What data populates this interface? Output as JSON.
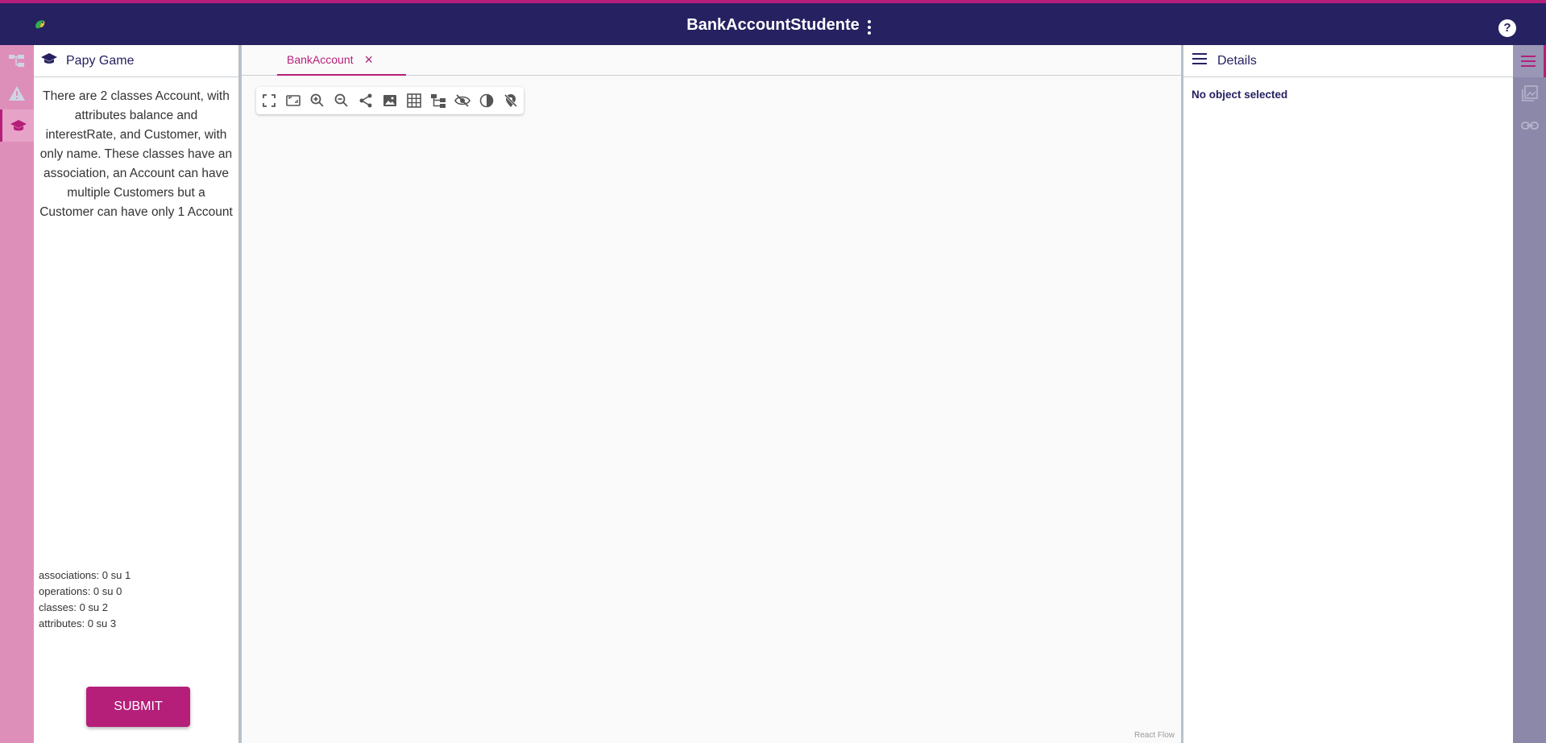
{
  "app": {
    "title": "BankAccountStudente",
    "help_label": "?"
  },
  "left_rail": {
    "items": [
      {
        "icon": "diagram-tree-icon",
        "active": false
      },
      {
        "icon": "warning-icon",
        "active": false
      },
      {
        "icon": "graduation-cap-icon",
        "active": true
      }
    ]
  },
  "game_panel": {
    "title": "Papy Game",
    "description": "There are 2 classes Account, with attributes balance and interestRate, and Customer, with only name. These classes have an association, an Account can have multiple Customers but a Customer can have only 1 Account",
    "stats": [
      "associations: 0 su 1",
      "operations: 0 su 0",
      "classes: 0 su 2",
      "attributes: 0 su 3"
    ],
    "submit_label": "SUBMIT"
  },
  "canvas": {
    "tab_label": "BankAccount",
    "close_icon": "×",
    "toolbar": [
      "fullscreen-icon",
      "fit-view-icon",
      "zoom-in-icon",
      "zoom-out-icon",
      "share-icon",
      "image-export-icon",
      "grid-icon",
      "auto-layout-icon",
      "hide-icon",
      "contrast-icon",
      "location-off-icon"
    ],
    "attribution": "React Flow"
  },
  "details": {
    "title": "Details",
    "empty_text": "No object selected"
  },
  "right_rail": {
    "items": [
      {
        "icon": "menu-icon",
        "active": true
      },
      {
        "icon": "gallery-icon",
        "active": false
      },
      {
        "icon": "link-icon",
        "active": false
      }
    ]
  },
  "colors": {
    "topbar": "#262161",
    "accent": "#b51f7a",
    "left_rail": "#de8fb9",
    "right_rail": "#8c88aa"
  }
}
